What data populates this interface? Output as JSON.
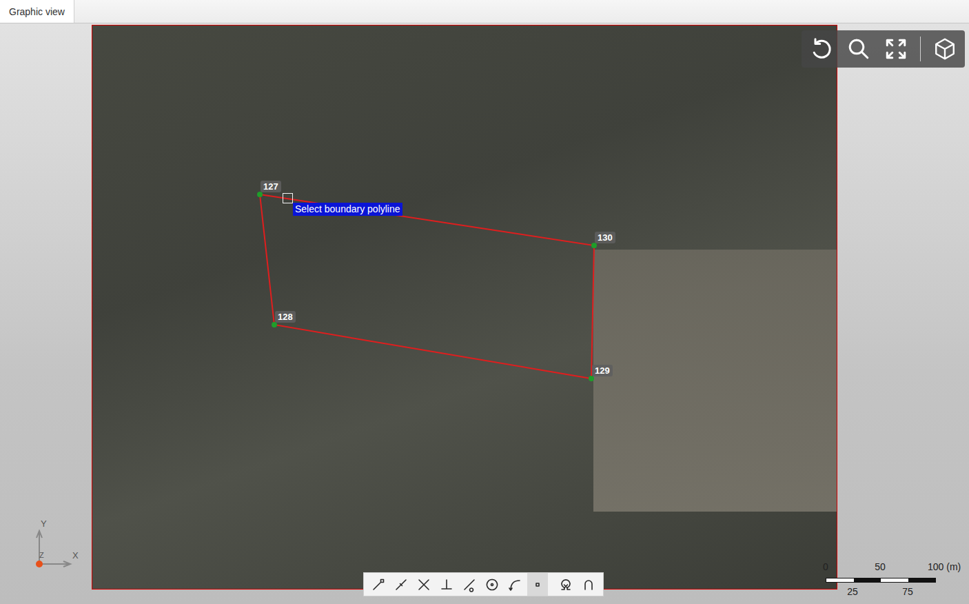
{
  "tabs": [
    {
      "label": "Graphic view",
      "selected": true
    }
  ],
  "boundary": {
    "points": [
      {
        "label": "127"
      },
      {
        "label": "130"
      },
      {
        "label": "129"
      },
      {
        "label": "128"
      }
    ],
    "closed": true,
    "color": "#e01e1e"
  },
  "hint": "Select boundary polyline",
  "snap_tools": [
    {
      "selected": false
    },
    {
      "selected": false
    },
    {
      "selected": false
    },
    {
      "selected": false
    },
    {
      "selected": false
    },
    {
      "selected": false
    },
    {
      "selected": false
    },
    {
      "selected": true
    },
    {
      "selected": false
    },
    {
      "selected": false
    }
  ],
  "scale_bar": {
    "top_labels": [
      "0",
      "50",
      "100 (m)"
    ],
    "bottom_labels": [
      "25",
      "75"
    ]
  },
  "axes": {
    "labels": [
      "Y",
      "Z",
      "X"
    ]
  }
}
